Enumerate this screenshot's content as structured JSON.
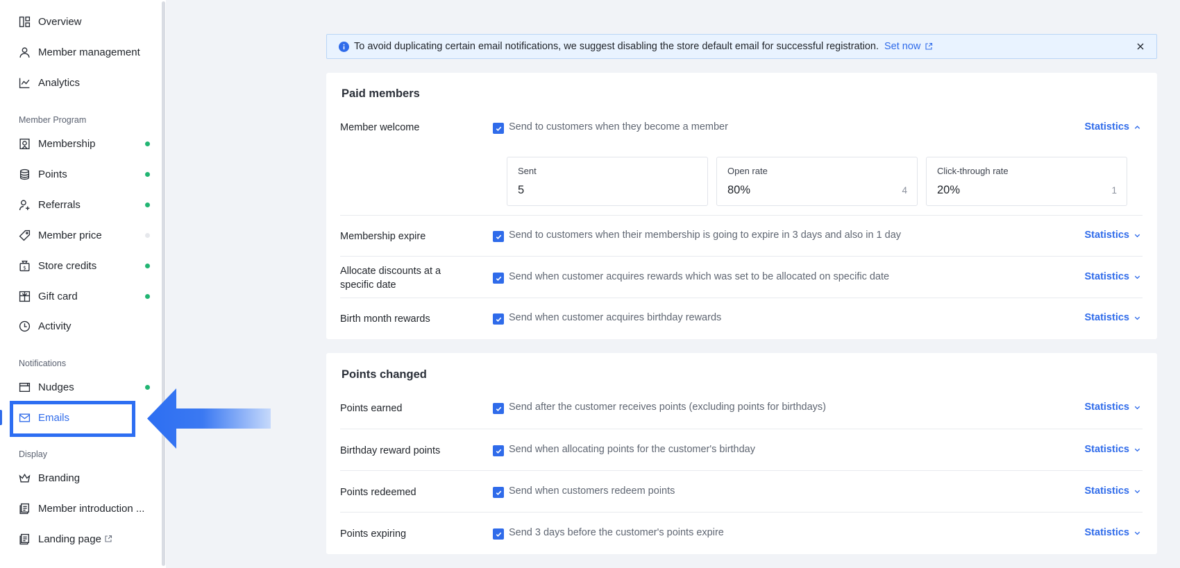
{
  "sidebar": {
    "items": [
      {
        "label": "Overview",
        "icon": "overview-icon"
      },
      {
        "label": "Member management",
        "icon": "person-icon"
      },
      {
        "label": "Analytics",
        "icon": "line-chart-icon"
      }
    ],
    "member_program_label": "Member Program",
    "member_program_items": [
      {
        "label": "Membership",
        "icon": "badge-icon",
        "dot": "on"
      },
      {
        "label": "Points",
        "icon": "coins-icon",
        "dot": "on"
      },
      {
        "label": "Referrals",
        "icon": "person-add-icon",
        "dot": "on"
      },
      {
        "label": "Member price",
        "icon": "tag-icon",
        "dot": "off"
      },
      {
        "label": "Store credits",
        "icon": "wallet-icon",
        "dot": "on"
      },
      {
        "label": "Gift card",
        "icon": "gift-card-icon",
        "dot": "on"
      },
      {
        "label": "Activity",
        "icon": "clock-icon",
        "dot": "none"
      }
    ],
    "notifications_label": "Notifications",
    "notifications_items": [
      {
        "label": "Nudges",
        "icon": "window-icon",
        "dot": "on"
      },
      {
        "label": "Emails",
        "icon": "mail-icon",
        "dot": "none",
        "active": true
      }
    ],
    "display_label": "Display",
    "display_items": [
      {
        "label": "Branding",
        "icon": "crown-icon"
      },
      {
        "label": "Member introduction ...",
        "icon": "page-icon"
      },
      {
        "label": "Landing page",
        "icon": "page-icon"
      }
    ]
  },
  "banner": {
    "text": "To avoid duplicating certain email notifications, we suggest disabling the store default email for successful registration.",
    "link": "Set now"
  },
  "paid_members": {
    "title": "Paid members",
    "rows": [
      {
        "name": "Member welcome",
        "desc": "Send to customers when they become a member",
        "stats": "Statistics",
        "expanded": true
      },
      {
        "name": "Membership expire",
        "desc": "Send to customers when their membership is going to expire in 3 days and also in 1 day",
        "stats": "Statistics"
      },
      {
        "name": "Allocate discounts at a specific date",
        "desc": "Send when customer acquires rewards which was set to be allocated on specific date",
        "stats": "Statistics"
      },
      {
        "name": "Birth month rewards",
        "desc": "Send when customer acquires birthday rewards",
        "stats": "Statistics"
      }
    ],
    "stats_boxes": [
      {
        "label": "Sent",
        "value": "5",
        "count": ""
      },
      {
        "label": "Open rate",
        "value": "80%",
        "count": "4"
      },
      {
        "label": "Click-through rate",
        "value": "20%",
        "count": "1"
      }
    ]
  },
  "points_changed": {
    "title": "Points changed",
    "rows": [
      {
        "name": "Points earned",
        "desc": "Send after the customer receives points (excluding points for birthdays)",
        "stats": "Statistics"
      },
      {
        "name": "Birthday reward points",
        "desc": "Send when allocating points for the customer's birthday",
        "stats": "Statistics"
      },
      {
        "name": "Points redeemed",
        "desc": "Send when customers redeem points",
        "stats": "Statistics"
      },
      {
        "name": "Points expiring",
        "desc": "Send 3 days before the customer's points expire",
        "stats": "Statistics"
      }
    ]
  },
  "colors": {
    "accent": "#2f6bea",
    "dot_on": "#22b573",
    "highlight": "#2d6ef2"
  }
}
